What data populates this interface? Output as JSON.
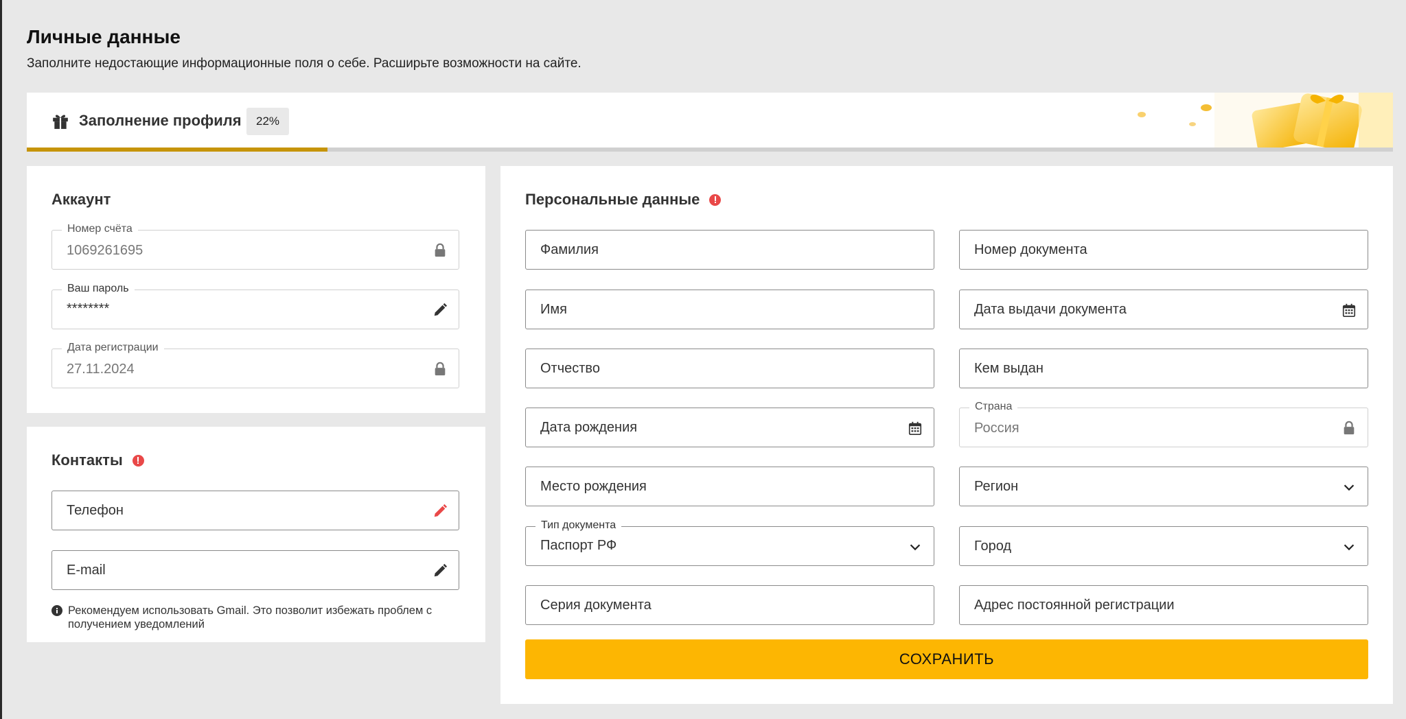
{
  "page": {
    "title": "Личные данные",
    "subtitle": "Заполните недостающие информационные поля о себе. Расширьте возможности на сайте."
  },
  "profile_progress": {
    "label": "Заполнение профиля",
    "percent_text": "22%",
    "percent": 22,
    "fill_color": "#c6940a",
    "icon": "gift-icon"
  },
  "account": {
    "title": "Аккаунт",
    "fields": {
      "account_number": {
        "label": "Номер счёта",
        "value": "1069261695",
        "icon": "lock-icon"
      },
      "password": {
        "label": "Ваш пароль",
        "value": "********",
        "icon": "pencil-icon"
      },
      "registration_date": {
        "label": "Дата регистрации",
        "value": "27.11.2024",
        "icon": "lock-icon"
      }
    }
  },
  "contacts": {
    "title": "Контакты",
    "phone": {
      "placeholder": "Телефон",
      "icon": "pencil-icon",
      "icon_color": "#e94848"
    },
    "email": {
      "placeholder": "E-mail",
      "icon": "pencil-icon"
    },
    "note": "Рекомендуем использовать Gmail. Это позволит избежать проблем с получением уведомлений"
  },
  "personal": {
    "title": "Персональные данные",
    "left": {
      "last_name": "Фамилия",
      "first_name": "Имя",
      "patronymic": "Отчество",
      "birth_date": "Дата рождения",
      "birth_place": "Место рождения",
      "doc_type": {
        "label": "Тип документа",
        "value": "Паспорт РФ"
      },
      "doc_series": "Серия документа"
    },
    "right": {
      "doc_number": "Номер документа",
      "doc_issue_date": "Дата выдачи документа",
      "issued_by": "Кем выдан",
      "country": {
        "label": "Страна",
        "value": "Россия"
      },
      "region": "Регион",
      "city": "Город",
      "address": "Адрес постоянной регистрации"
    },
    "save_label": "СОХРАНИТЬ"
  },
  "colors": {
    "accent": "#fdb602",
    "warning": "#e94848",
    "background": "#e8e8e8"
  }
}
